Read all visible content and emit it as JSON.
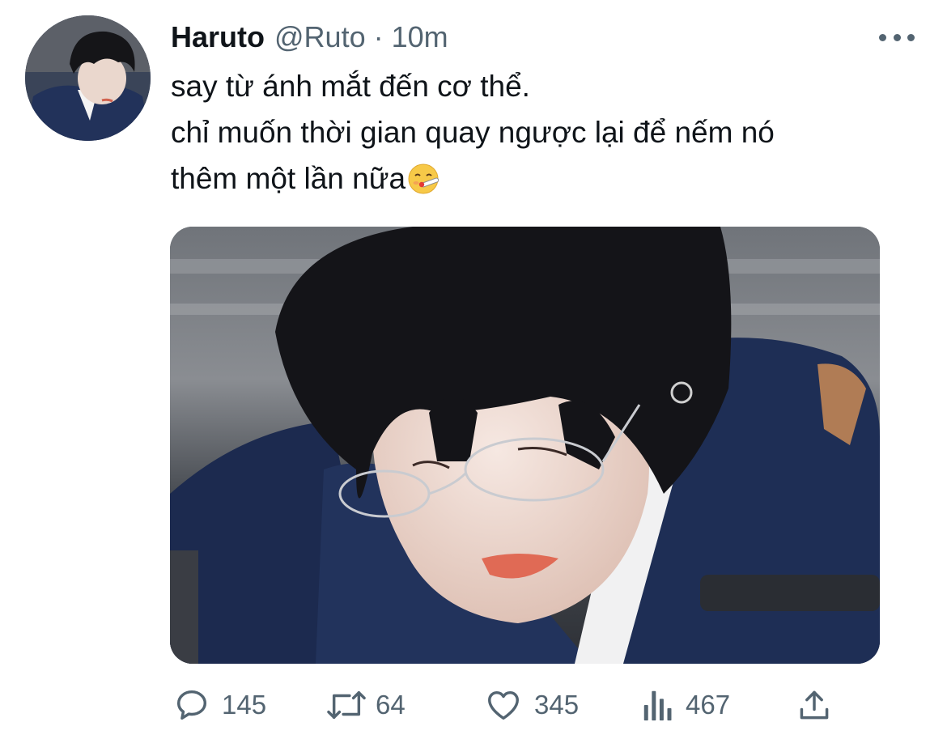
{
  "tweet": {
    "display_name": "Haruto",
    "handle": "@Ruto",
    "separator": "·",
    "time": "10m",
    "text_lines": [
      "say từ ánh mắt đến cơ thể.",
      "chỉ muốn thời gian quay ngược lại để nếm nó",
      "thêm một lần nữa"
    ],
    "emoji": "face-with-thermometer"
  },
  "actions": {
    "reply_count": "145",
    "retweet_count": "64",
    "like_count": "345",
    "views_count": "467"
  },
  "icons": {
    "reply": "reply-icon",
    "retweet": "retweet-icon",
    "like": "heart-icon",
    "views": "views-icon",
    "share": "share-icon",
    "more": "more-icon"
  },
  "colors": {
    "text_primary": "#0f1419",
    "text_secondary": "#536471"
  }
}
